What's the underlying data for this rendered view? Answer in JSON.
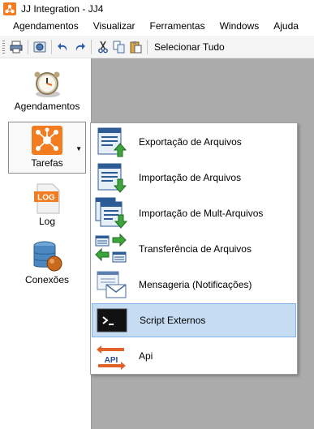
{
  "window": {
    "title": "JJ Integration - JJ4"
  },
  "menubar": {
    "items": [
      "Agendamentos",
      "Visualizar",
      "Ferramentas",
      "Windows",
      "Ajuda"
    ]
  },
  "toolbar": {
    "select_all_label": "Selecionar Tudo"
  },
  "nav": {
    "agendamentos": "Agendamentos",
    "tarefas": "Tarefas",
    "log": "Log",
    "log_icon_text": "LOG",
    "conexoes": "Conexões"
  },
  "dropdown": {
    "items": [
      {
        "label": "Exportação de Arquivos",
        "icon": "export-files-icon"
      },
      {
        "label": "Importação de Arquivos",
        "icon": "import-files-icon"
      },
      {
        "label": "Importação de Mult-Arquivos",
        "icon": "import-multi-files-icon"
      },
      {
        "label": "Transferência de Arquivos",
        "icon": "transfer-files-icon"
      },
      {
        "label": "Mensageria (Notificações)",
        "icon": "messaging-icon"
      },
      {
        "label": "Script Externos",
        "icon": "terminal-icon",
        "selected": true
      },
      {
        "label": "Api",
        "icon": "api-icon",
        "icon_text": "API"
      }
    ]
  },
  "colors": {
    "workspace": "#ababab",
    "selection_bg": "#c5dcf2",
    "selection_border": "#7eb4ea",
    "tarefas_icon": "#f47c20"
  }
}
